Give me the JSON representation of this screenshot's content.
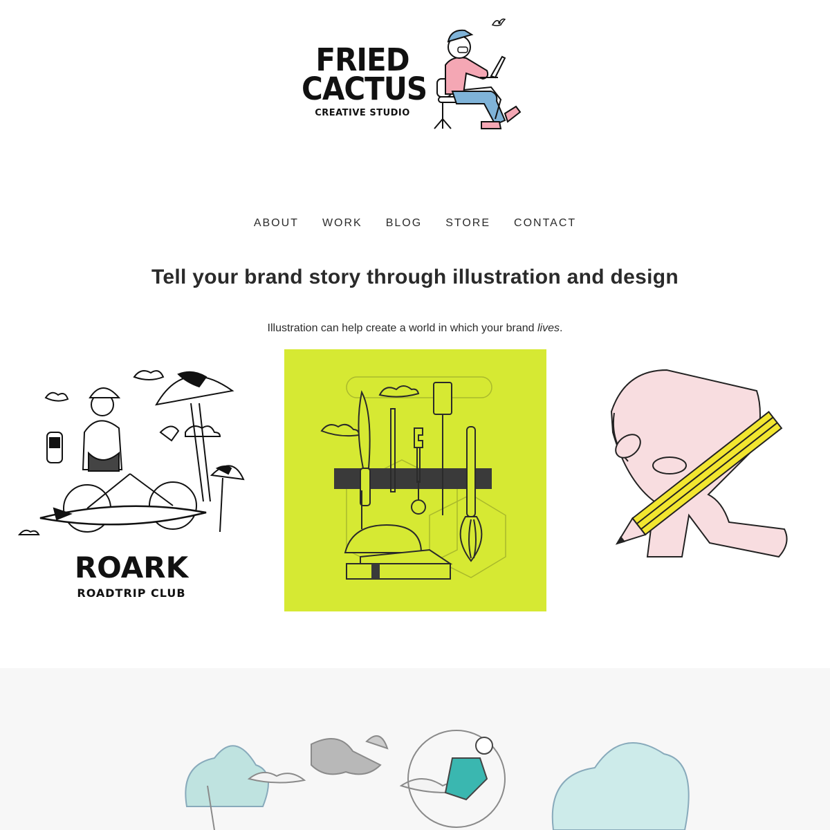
{
  "logo": {
    "line1": "FRIED",
    "line2": "CACTUS",
    "line3": "CREATIVE STUDIO"
  },
  "nav": [
    {
      "label": "ABOUT"
    },
    {
      "label": "WORK"
    },
    {
      "label": "BLOG"
    },
    {
      "label": "STORE"
    },
    {
      "label": "CONTACT"
    }
  ],
  "hero": {
    "headline": "Tell your brand story through illustration and design",
    "subline_before": "Illustration can help create a world in which your brand ",
    "subline_em": "lives",
    "subline_after": "."
  },
  "tiles": [
    {
      "logo_main": "ROARK",
      "logo_sub": "ROADTRIP CLUB"
    },
    {},
    {}
  ],
  "colors": {
    "accent_lime": "#d6e933",
    "pink": "#f5c2cc",
    "teal": "#3ab7b0",
    "yellow": "#f2e630",
    "bg_band": "#f7f7f7"
  }
}
